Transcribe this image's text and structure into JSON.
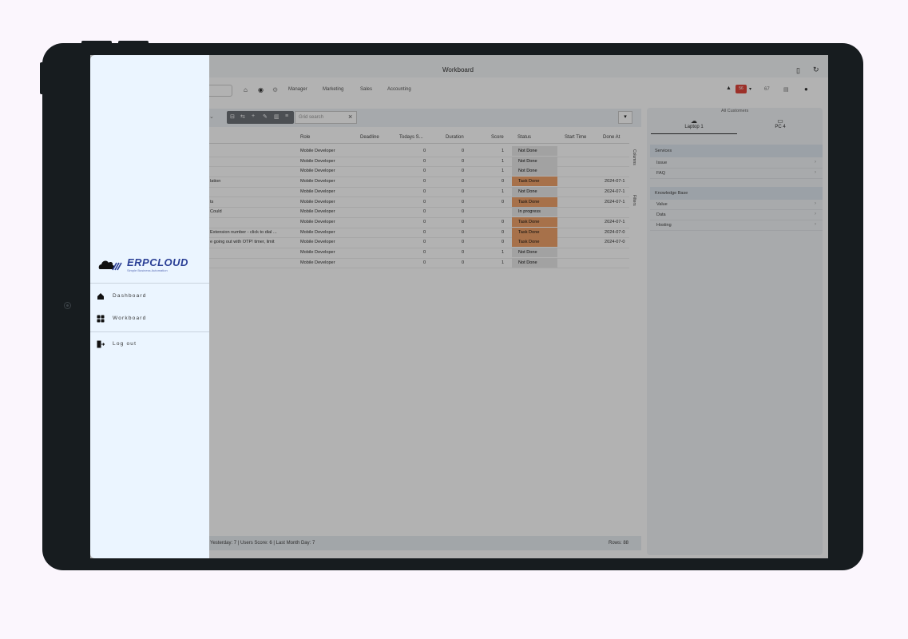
{
  "app": {
    "title": "Workboard",
    "search_placeholder": ""
  },
  "menu": [
    "Manager",
    "Marketing",
    "Sales",
    "Accounting"
  ],
  "topright": {
    "badge": "56",
    "user_short": "67"
  },
  "toolbar": {
    "grid_search_placeholder": "Grid search"
  },
  "table": {
    "headers": [
      "Role",
      "Deadline",
      "Todays S...",
      "Duration",
      "Score",
      "Status",
      "Start Time",
      "Done At"
    ],
    "rows": [
      {
        "desc": "",
        "role": "Mobile Developer",
        "todays": "0",
        "duration": "0",
        "score": "1",
        "status": "Not Done",
        "start": "",
        "done": "",
        "done_style": "plain"
      },
      {
        "desc": "",
        "role": "Mobile Developer",
        "todays": "0",
        "duration": "0",
        "score": "1",
        "status": "Not Done",
        "start": "",
        "done": "",
        "done_style": "plain"
      },
      {
        "desc": "",
        "role": "Mobile Developer",
        "todays": "0",
        "duration": "0",
        "score": "1",
        "status": "Not Done",
        "start": "",
        "done": "",
        "done_style": "plain"
      },
      {
        "desc": "lation",
        "role": "Mobile Developer",
        "todays": "0",
        "duration": "0",
        "score": "0",
        "status": "Task Done",
        "start": "",
        "done": "2024-07-1",
        "done_style": "done"
      },
      {
        "desc": "",
        "role": "Mobile Developer",
        "todays": "0",
        "duration": "0",
        "score": "1",
        "status": "Not Done",
        "start": "",
        "done": "2024-07-1",
        "done_style": "plain"
      },
      {
        "desc": "ts",
        "role": "Mobile Developer",
        "todays": "0",
        "duration": "0",
        "score": "0",
        "status": "Task Done",
        "start": "",
        "done": "2024-07-1",
        "done_style": "done"
      },
      {
        "desc": "Could ",
        "role": "Mobile Developer",
        "todays": "0",
        "duration": "0",
        "score": "",
        "status": "In progress",
        "start": "",
        "done": "",
        "done_style": "progress"
      },
      {
        "desc": "",
        "role": "Mobile Developer",
        "todays": "0",
        "duration": "0",
        "score": "0",
        "status": "Task Done",
        "start": "",
        "done": "2024-07-1",
        "done_style": "done"
      },
      {
        "desc": "Extension number - click to dial ...",
        "role": "Mobile Developer",
        "todays": "0",
        "duration": "0",
        "score": "0",
        "status": "Task Done",
        "start": "",
        "done": "2024-07-0",
        "done_style": "done"
      },
      {
        "desc": "e going out with OTP! timer, limit",
        "role": "Mobile Developer",
        "todays": "0",
        "duration": "0",
        "score": "0",
        "status": "Task Done",
        "start": "",
        "done": "2024-07-0",
        "done_style": "done"
      },
      {
        "desc": "",
        "role": "Mobile Developer",
        "todays": "0",
        "duration": "0",
        "score": "1",
        "status": "Not Done",
        "start": "",
        "done": "",
        "done_style": "plain"
      },
      {
        "desc": "",
        "role": "Mobile Developer",
        "todays": "0",
        "duration": "0",
        "score": "1",
        "status": "Not Done",
        "start": "",
        "done": "",
        "done_style": "plain"
      }
    ]
  },
  "side_tabs": [
    "Columns",
    "Filters"
  ],
  "footer": {
    "left": "Yesterday: 7 | Users Score: 6 | Last Month Day: 7",
    "right": "Rows: 88"
  },
  "right_panel": {
    "title": "All Customers",
    "tabs": [
      "Laptop 1",
      "PC 4"
    ],
    "services_header": "Services",
    "services": [
      "Issue",
      "FAQ"
    ],
    "kb_header": "Knowledge Base",
    "kb_items": [
      "Value",
      "Data",
      "Hosting"
    ]
  },
  "drawer": {
    "logo_text": "ERPCLOUD",
    "logo_sub": "Simple Business Automation",
    "nav": [
      {
        "label": "Dashboard",
        "icon": "home-icon"
      },
      {
        "label": "Workboard",
        "icon": "grid-icon"
      }
    ],
    "logout": {
      "label": "Log out",
      "icon": "logout-icon"
    }
  },
  "colors": {
    "drawer_bg": "#ebf5ff",
    "task_done": "#f0a26a",
    "status_col": "#e9e9e9",
    "brand": "#2a3f96"
  }
}
